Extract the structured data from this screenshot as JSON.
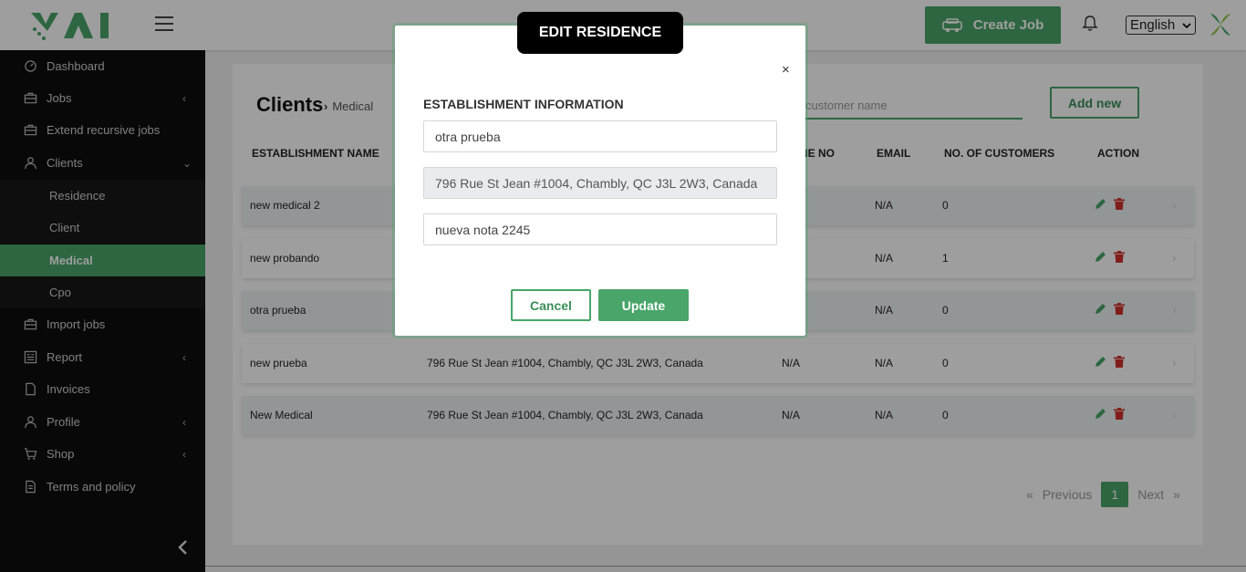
{
  "header": {
    "create_job_label": "Create Job",
    "language_selected": "English",
    "accent_color": "#49a56a"
  },
  "sidebar": {
    "items": [
      {
        "label": "Dashboard",
        "icon": "dashboard-icon",
        "has_submenu": false
      },
      {
        "label": "Jobs",
        "icon": "briefcase-icon",
        "has_submenu": true
      },
      {
        "label": "Extend recursive jobs",
        "icon": "briefcase-icon",
        "has_submenu": false
      },
      {
        "label": "Clients",
        "icon": "user-icon",
        "has_submenu": true,
        "expanded": true
      },
      {
        "label": "Import jobs",
        "icon": "briefcase-icon",
        "has_submenu": false
      },
      {
        "label": "Report",
        "icon": "report-icon",
        "has_submenu": true
      },
      {
        "label": "Invoices",
        "icon": "document-icon",
        "has_submenu": false
      },
      {
        "label": "Profile",
        "icon": "user-icon",
        "has_submenu": true
      },
      {
        "label": "Shop",
        "icon": "cart-icon",
        "has_submenu": true
      },
      {
        "label": "Terms and policy",
        "icon": "document-icon",
        "has_submenu": false
      }
    ],
    "client_subitems": [
      {
        "label": "Residence",
        "active": false
      },
      {
        "label": "Client",
        "active": false
      },
      {
        "label": "Medical",
        "active": true
      },
      {
        "label": "Cpo",
        "active": false
      }
    ]
  },
  "main": {
    "title": "Clients",
    "breadcrumb": "Medical",
    "search_placeholder": "customer name",
    "add_new_label": "Add new",
    "columns": [
      "ESTABLISHMENT NAME",
      "NE NO",
      "EMAIL",
      "NO. OF CUSTOMERS",
      "ACTION"
    ],
    "rows": [
      {
        "name": "new medical 2",
        "address": "",
        "phone": "",
        "email": "N/A",
        "customers": "0"
      },
      {
        "name": "new probando",
        "address": "",
        "phone": "",
        "email": "N/A",
        "customers": "1"
      },
      {
        "name": "otra prueba",
        "address": "",
        "phone": "",
        "email": "N/A",
        "customers": "0"
      },
      {
        "name": "new prueba",
        "address": "796 Rue St Jean #1004, Chambly, QC J3L 2W3, Canada",
        "phone": "N/A",
        "email": "N/A",
        "customers": "0"
      },
      {
        "name": "New Medical",
        "address": "796 Rue St Jean #1004, Chambly, QC J3L 2W3, Canada",
        "phone": "N/A",
        "email": "N/A",
        "customers": "0"
      }
    ],
    "pagination": {
      "previous": "Previous",
      "current": "1",
      "next": "Next"
    }
  },
  "modal": {
    "title": "EDIT RESIDENCE",
    "close_symbol": "×",
    "section_title": "ESTABLISHMENT INFORMATION",
    "name_value": "otra prueba",
    "address_value": "796 Rue St Jean #1004, Chambly, QC J3L 2W3, Canada",
    "note_value": "nueva nota 2245",
    "cancel_label": "Cancel",
    "update_label": "Update"
  }
}
